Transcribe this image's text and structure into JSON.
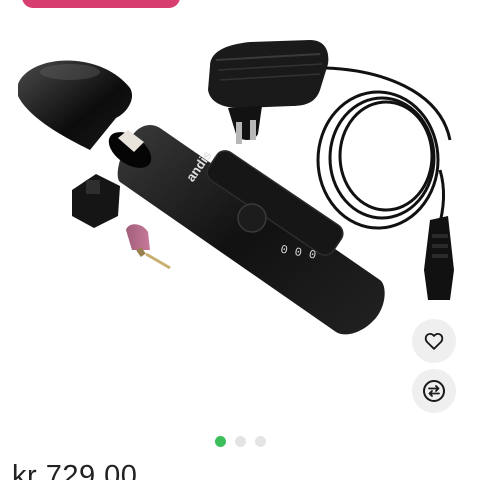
{
  "product": {
    "price": "kr 729,00",
    "brand_mark": "andis",
    "display_digits": "0 0 0"
  },
  "actions": {
    "wishlist_icon": "heart-icon",
    "compare_icon": "compare-arrows-icon"
  },
  "gallery": {
    "slide_count": 3,
    "active_index": 0
  },
  "colors": {
    "badge": "#d83d70",
    "active_dot": "#3dbf5c",
    "inactive_dot": "#e4e4e4",
    "fab_background": "#efefef"
  }
}
